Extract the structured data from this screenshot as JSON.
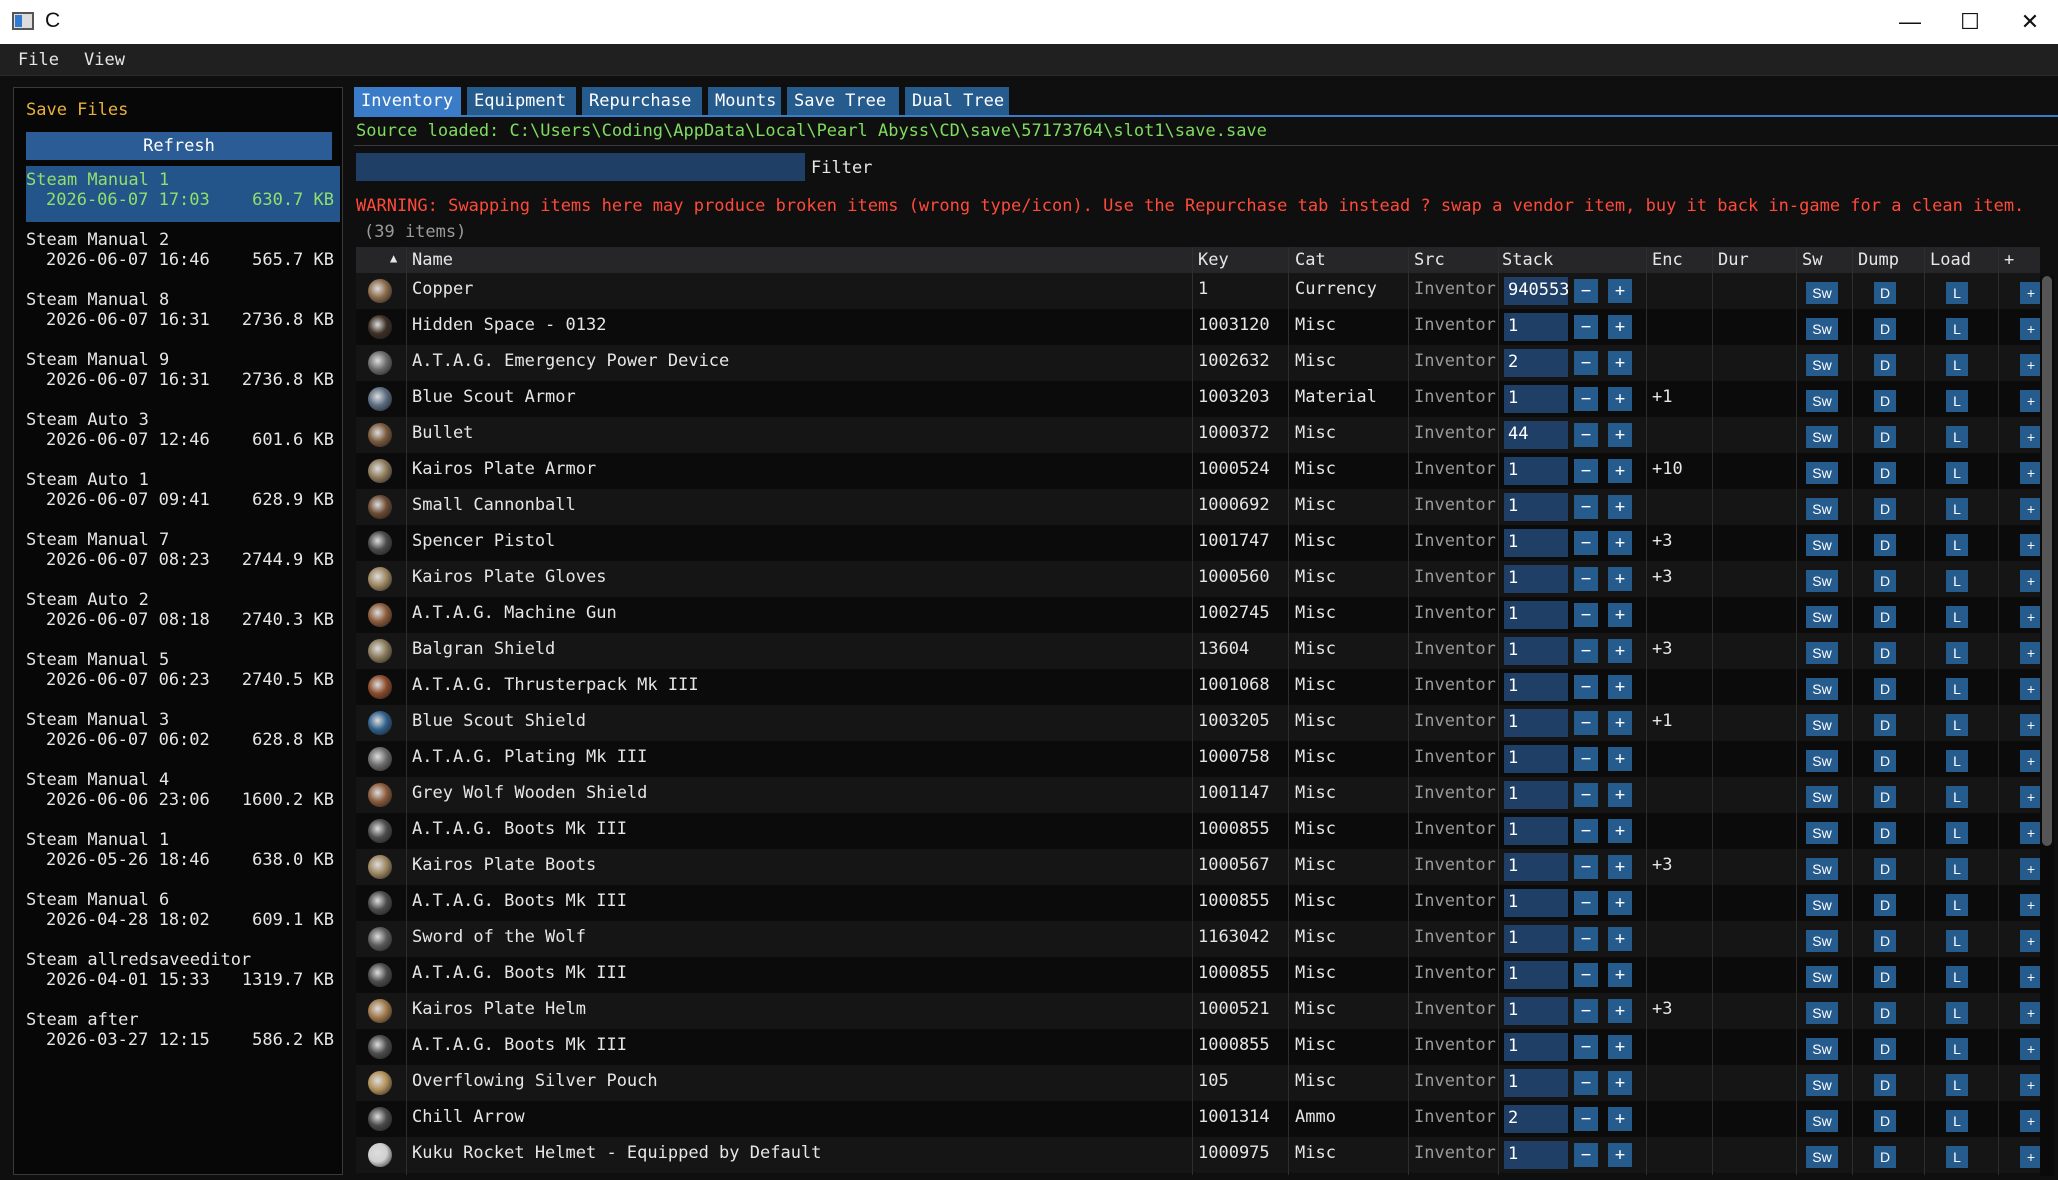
{
  "window": {
    "title": "C",
    "minimize": "—",
    "maximize": "☐",
    "close": "✕"
  },
  "menu": {
    "file": "File",
    "view": "View"
  },
  "sidebar": {
    "title": "Save Files",
    "refresh_label": "Refresh",
    "saves": [
      {
        "name": "Steam Manual 1",
        "date": "2026-06-07 17:03",
        "size": "630.7 KB",
        "selected": true
      },
      {
        "name": "Steam Manual 2",
        "date": "2026-06-07 16:46",
        "size": "565.7 KB"
      },
      {
        "name": "Steam Manual 8",
        "date": "2026-06-07 16:31",
        "size": "2736.8 KB"
      },
      {
        "name": "Steam Manual 9",
        "date": "2026-06-07 16:31",
        "size": "2736.8 KB"
      },
      {
        "name": "Steam Auto 3",
        "date": "2026-06-07 12:46",
        "size": "601.6 KB"
      },
      {
        "name": "Steam Auto 1",
        "date": "2026-06-07 09:41",
        "size": "628.9 KB"
      },
      {
        "name": "Steam Manual 7",
        "date": "2026-06-07 08:23",
        "size": "2744.9 KB"
      },
      {
        "name": "Steam Auto 2",
        "date": "2026-06-07 08:18",
        "size": "2740.3 KB"
      },
      {
        "name": "Steam Manual 5",
        "date": "2026-06-07 06:23",
        "size": "2740.5 KB"
      },
      {
        "name": "Steam Manual 3",
        "date": "2026-06-07 06:02",
        "size": "628.8 KB"
      },
      {
        "name": "Steam Manual 4",
        "date": "2026-06-06 23:06",
        "size": "1600.2 KB"
      },
      {
        "name": "Steam Manual 1",
        "date": "2026-05-26 18:46",
        "size": "638.0 KB"
      },
      {
        "name": "Steam Manual 6",
        "date": "2026-04-28 18:02",
        "size": "609.1 KB"
      },
      {
        "name": "Steam allredsaveeditor",
        "date": "2026-04-01 15:33",
        "size": "1319.7 KB"
      },
      {
        "name": "Steam after",
        "date": "2026-03-27 12:15",
        "size": "586.2 KB"
      }
    ]
  },
  "tabs": [
    "Inventory",
    "Equipment",
    "Repurchase",
    "Mounts",
    "Save Tree",
    "Dual Tree"
  ],
  "source_text": "Source loaded: C:\\Users\\Coding\\AppData\\Local\\Pearl Abyss\\CD\\save\\57173764\\slot1\\save.save",
  "filter_label": "Filter",
  "warning": "WARNING: Swapping items here may produce broken items (wrong type/icon). Use the Repurchase tab instead ? swap a vendor item, buy it back in-game for a clean item.",
  "count": "(39 items)",
  "columns": {
    "sort": "▲",
    "name": "Name",
    "key": "Key",
    "cat": "Cat",
    "src": "Src",
    "stack": "Stack",
    "enc": "Enc",
    "dur": "Dur",
    "sw": "Sw",
    "dump": "Dump",
    "load": "Load",
    "add": "+"
  },
  "buttons": {
    "minus": "−",
    "plus": "+",
    "sw": "Sw",
    "d": "D",
    "l": "L",
    "add": "+"
  },
  "rows": [
    {
      "name": "Copper",
      "key": "1",
      "cat": "Currency",
      "src": "Inventor",
      "stack": "940553",
      "enc": "",
      "icon": "coin-icon",
      "color": "#8a6a4a"
    },
    {
      "name": "Hidden Space - 0132",
      "key": "1003120",
      "cat": "Misc",
      "src": "Inventor",
      "stack": "1",
      "enc": "",
      "icon": "space-icon",
      "color": "#3c2f26"
    },
    {
      "name": "A.T.A.G. Emergency Power Device",
      "key": "1002632",
      "cat": "Misc",
      "src": "Inventor",
      "stack": "2",
      "enc": "",
      "icon": "device-icon",
      "color": "#6b6b6b"
    },
    {
      "name": "Blue Scout Armor",
      "key": "1003203",
      "cat": "Material",
      "src": "Inventor",
      "stack": "1",
      "enc": "+1",
      "icon": "armor-icon",
      "color": "#5b6c80"
    },
    {
      "name": "Bullet",
      "key": "1000372",
      "cat": "Misc",
      "src": "Inventor",
      "stack": "44",
      "enc": "",
      "icon": "bullet-icon",
      "color": "#7a5a3c"
    },
    {
      "name": "Kairos Plate Armor",
      "key": "1000524",
      "cat": "Misc",
      "src": "Inventor",
      "stack": "1",
      "enc": "+10",
      "icon": "plate-armor-icon",
      "color": "#8c7a5a"
    },
    {
      "name": "Small Cannonball",
      "key": "1000692",
      "cat": "Misc",
      "src": "Inventor",
      "stack": "1",
      "enc": "",
      "icon": "cannonball-icon",
      "color": "#6c4a34"
    },
    {
      "name": "Spencer Pistol",
      "key": "1001747",
      "cat": "Misc",
      "src": "Inventor",
      "stack": "1",
      "enc": "+3",
      "icon": "pistol-icon",
      "color": "#4a4a4a"
    },
    {
      "name": "Kairos Plate Gloves",
      "key": "1000560",
      "cat": "Misc",
      "src": "Inventor",
      "stack": "1",
      "enc": "+3",
      "icon": "gloves-icon",
      "color": "#9c8660"
    },
    {
      "name": "A.T.A.G. Machine Gun",
      "key": "1002745",
      "cat": "Misc",
      "src": "Inventor",
      "stack": "1",
      "enc": "",
      "icon": "machine-gun-icon",
      "color": "#8a5a3a"
    },
    {
      "name": "Balgran Shield",
      "key": "13604",
      "cat": "Misc",
      "src": "Inventor",
      "stack": "1",
      "enc": "+3",
      "icon": "shield-icon",
      "color": "#8a7a5a"
    },
    {
      "name": "A.T.A.G. Thrusterpack Mk III",
      "key": "1001068",
      "cat": "Misc",
      "src": "Inventor",
      "stack": "1",
      "enc": "",
      "icon": "thrusterpack-icon",
      "color": "#8a4a2a"
    },
    {
      "name": "Blue Scout Shield",
      "key": "1003205",
      "cat": "Misc",
      "src": "Inventor",
      "stack": "1",
      "enc": "+1",
      "icon": "round-shield-icon",
      "color": "#2f5f8a"
    },
    {
      "name": "A.T.A.G. Plating Mk III",
      "key": "1000758",
      "cat": "Misc",
      "src": "Inventor",
      "stack": "1",
      "enc": "",
      "icon": "plating-icon",
      "color": "#6a6a6a"
    },
    {
      "name": "Grey Wolf Wooden Shield",
      "key": "1001147",
      "cat": "Misc",
      "src": "Inventor",
      "stack": "1",
      "enc": "",
      "icon": "wooden-shield-icon",
      "color": "#8a5a3a"
    },
    {
      "name": "A.T.A.G. Boots Mk III",
      "key": "1000855",
      "cat": "Misc",
      "src": "Inventor",
      "stack": "1",
      "enc": "",
      "icon": "boots-icon",
      "color": "#4c4c4c"
    },
    {
      "name": "Kairos Plate Boots",
      "key": "1000567",
      "cat": "Misc",
      "src": "Inventor",
      "stack": "1",
      "enc": "+3",
      "icon": "plate-boots-icon",
      "color": "#9c8660"
    },
    {
      "name": "A.T.A.G. Boots Mk III",
      "key": "1000855",
      "cat": "Misc",
      "src": "Inventor",
      "stack": "1",
      "enc": "",
      "icon": "boots-icon",
      "color": "#4c4c4c"
    },
    {
      "name": "Sword of the Wolf",
      "key": "1163042",
      "cat": "Misc",
      "src": "Inventor",
      "stack": "1",
      "enc": "",
      "icon": "sword-icon",
      "color": "#5a5a5a"
    },
    {
      "name": "A.T.A.G. Boots Mk III",
      "key": "1000855",
      "cat": "Misc",
      "src": "Inventor",
      "stack": "1",
      "enc": "",
      "icon": "boots-icon",
      "color": "#4c4c4c"
    },
    {
      "name": "Kairos Plate Helm",
      "key": "1000521",
      "cat": "Misc",
      "src": "Inventor",
      "stack": "1",
      "enc": "+3",
      "icon": "helm-icon",
      "color": "#a0784a"
    },
    {
      "name": "A.T.A.G. Boots Mk III",
      "key": "1000855",
      "cat": "Misc",
      "src": "Inventor",
      "stack": "1",
      "enc": "",
      "icon": "boots-icon",
      "color": "#4c4c4c"
    },
    {
      "name": "Overflowing Silver Pouch",
      "key": "105",
      "cat": "Misc",
      "src": "Inventor",
      "stack": "1",
      "enc": "",
      "icon": "pouch-icon",
      "color": "#b0905a"
    },
    {
      "name": "Chill Arrow",
      "key": "1001314",
      "cat": "Ammo",
      "src": "Inventor",
      "stack": "2",
      "enc": "",
      "icon": "arrow-icon",
      "color": "#4a4a4a"
    },
    {
      "name": "Kuku Rocket Helmet - Equipped by Default",
      "key": "1000975",
      "cat": "Misc",
      "src": "Inventor",
      "stack": "1",
      "enc": "",
      "icon": "rocket-helmet-icon",
      "color": "#d0d0d0"
    }
  ],
  "colors": {
    "accent": "#3a7cc8",
    "button": "#265b8e",
    "input": "#1f3f66",
    "warning": "#ff4a3a",
    "source": "#7edc5e",
    "sidebar_title": "#e8b23a"
  }
}
